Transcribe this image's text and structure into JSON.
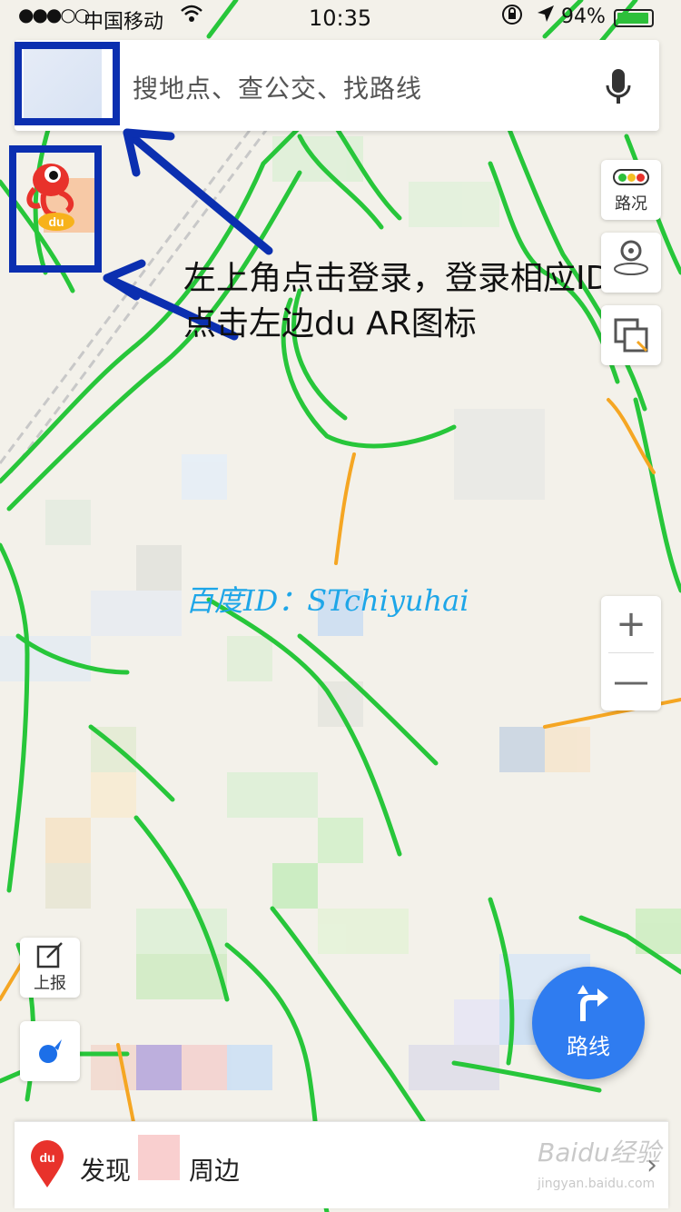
{
  "status_bar": {
    "signal": "●●●○○",
    "carrier": "中国移动",
    "time": "10:35",
    "battery": "94%",
    "battery_level": 0.94
  },
  "search": {
    "placeholder": "搜地点、查公交、找路线"
  },
  "annotation": {
    "line1": "左上角点击登录，登录相应ID",
    "line2": "点击左边du AR图标"
  },
  "watermark": {
    "id_text": "百度ID：STchiyuhai"
  },
  "controls": {
    "traffic_label": "路况",
    "zoom_in": "+",
    "zoom_out": "—",
    "report_label": "上报",
    "route_label": "路线"
  },
  "bottom_bar": {
    "pin_label": "du",
    "discover": "发现",
    "nearby": "周边",
    "baidu_brand": "Baidu经验",
    "baidu_url": "jingyan.baidu.com"
  },
  "colors": {
    "highlight": "#0b2fb0",
    "route_button": "#2f7cf0",
    "road_green": "#27c63a",
    "road_orange": "#f5a623",
    "watermark": "#1ea6e8"
  }
}
